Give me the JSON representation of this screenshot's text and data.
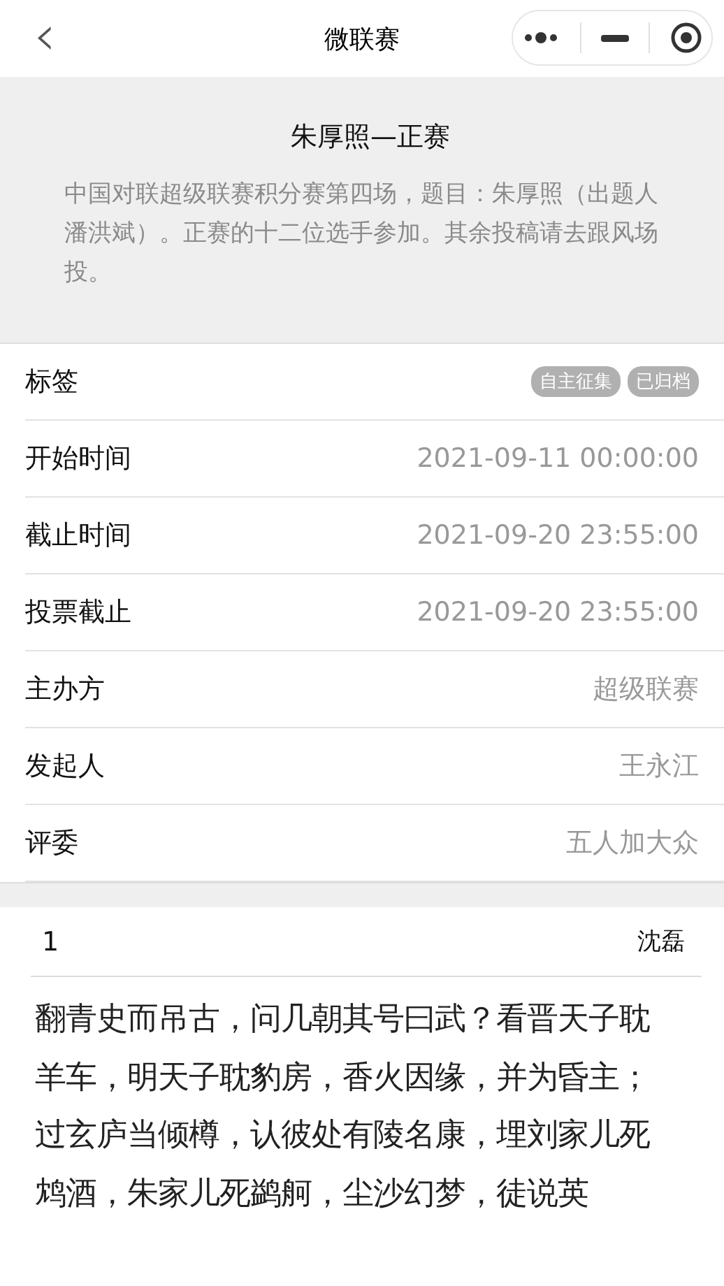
{
  "nav": {
    "back": "‹",
    "title": "微联赛"
  },
  "header": {
    "title": "朱厚照—正赛",
    "description": "中国对联超级联赛积分赛第四场，题目：朱厚照（出题人潘洪斌）。正赛的十二位选手参加。其余投稿请去跟风场投。"
  },
  "fields": [
    {
      "kind": "tags",
      "label": "标签",
      "tags": [
        "自主征集",
        "已归档"
      ]
    },
    {
      "kind": "text",
      "label": "开始时间",
      "value": "2021-09-11 00:00:00"
    },
    {
      "kind": "text",
      "label": "截止时间",
      "value": "2021-09-20 23:55:00"
    },
    {
      "kind": "text",
      "label": "投票截止",
      "value": "2021-09-20 23:55:00"
    },
    {
      "kind": "text",
      "label": "主办方",
      "value": "超级联赛"
    },
    {
      "kind": "text",
      "label": "发起人",
      "value": "王永江"
    },
    {
      "kind": "text",
      "label": "评委",
      "value": "五人加大众"
    }
  ],
  "entry": {
    "number": "1",
    "author": "沈磊",
    "lines": [
      "翻青史而吊古，问几朝其号曰武？看晋天子耽羊车，明天子耽豹房，香火因缘，并为昏主；",
      "过玄庐当倾樽，认彼处有陵名康，埋刘家儿死鸩酒，朱家儿死鹢舸，尘沙幻梦，徒说英"
    ]
  }
}
